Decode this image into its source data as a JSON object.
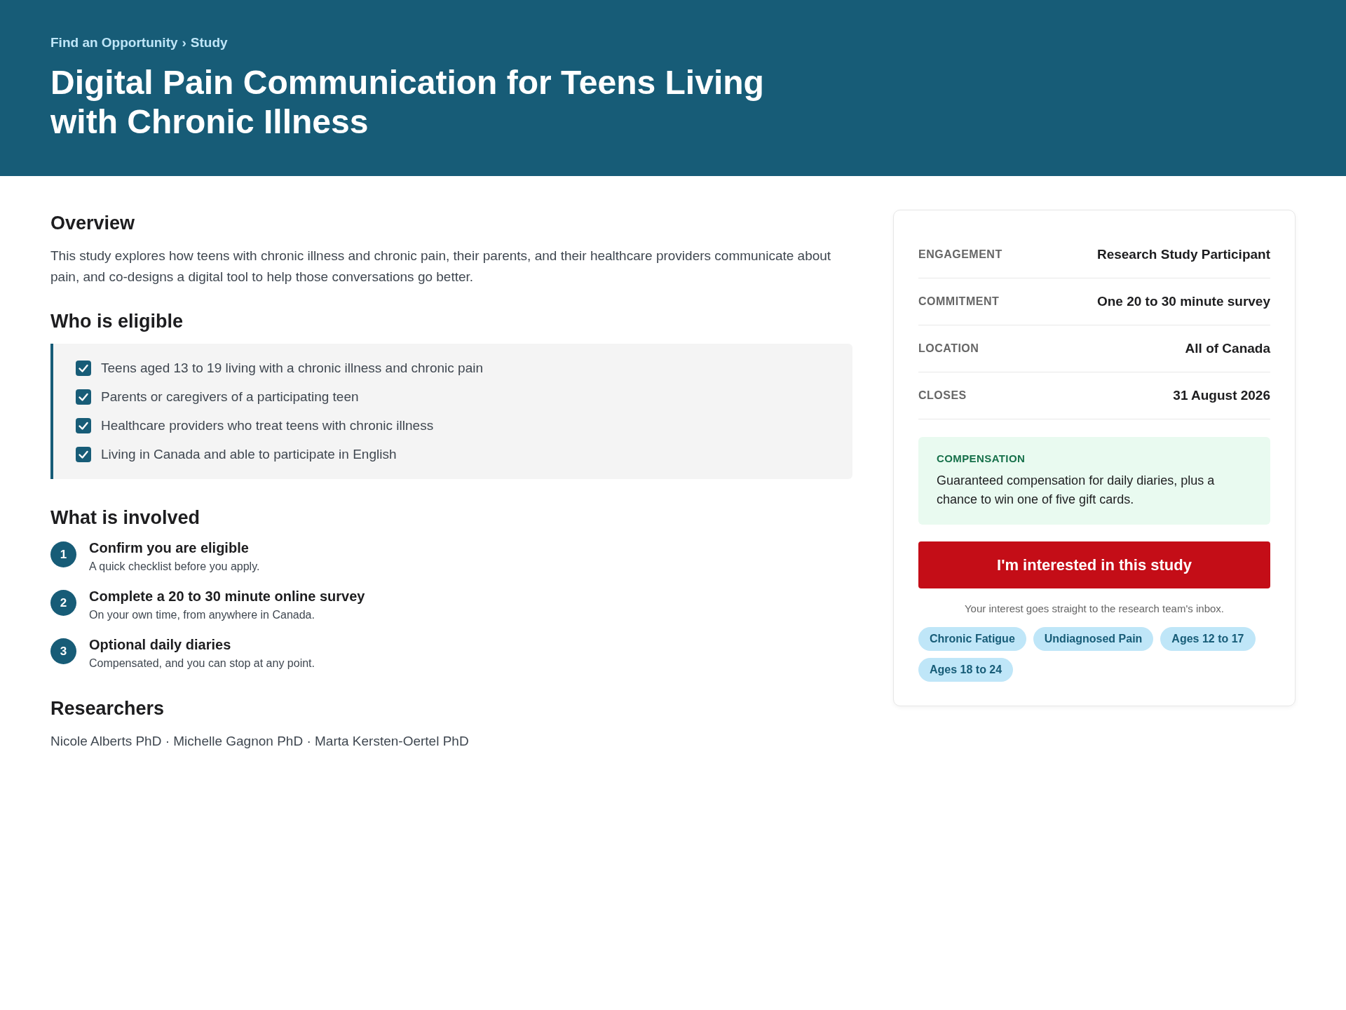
{
  "header": {
    "breadcrumb": {
      "items": [
        "Find an Opportunity",
        "Study"
      ],
      "separator": "›"
    },
    "title": "Digital Pain Communication for Teens Living with Chronic Illness"
  },
  "overview": {
    "heading": "Overview",
    "text": "This study explores how teens with chronic illness and chronic pain, their parents, and their healthcare providers communicate about pain, and co-designs a digital tool to help those conversations go better."
  },
  "eligibility": {
    "heading": "Who is eligible",
    "items": [
      {
        "text": "Teens aged 13 to 19 living with a chronic illness and chronic pain",
        "checked": true
      },
      {
        "text": "Parents or caregivers of a participating teen",
        "checked": true
      },
      {
        "text": "Healthcare providers who treat teens with chronic illness",
        "checked": true
      },
      {
        "text": "Living in Canada and able to participate in English",
        "checked": true
      }
    ]
  },
  "involved": {
    "heading": "What is involved",
    "steps": [
      {
        "number": "1",
        "title": "Confirm you are eligible",
        "text": "A quick checklist before you apply."
      },
      {
        "number": "2",
        "title": "Complete a 20 to 30 minute online survey",
        "text": "On your own time, from anywhere in Canada."
      },
      {
        "number": "3",
        "title": "Optional daily diaries",
        "text": "Compensated, and you can stop at any point."
      }
    ]
  },
  "researchers": {
    "heading": "Researchers",
    "text": "Nicole Alberts PhD · Michelle Gagnon PhD · Marta Kersten-Oertel PhD"
  },
  "sidebar": {
    "details": [
      {
        "label": "ENGAGEMENT",
        "value": "Research Study Participant"
      },
      {
        "label": "COMMITMENT",
        "value": "One 20 to 30 minute survey"
      },
      {
        "label": "LOCATION",
        "value": "All of Canada"
      },
      {
        "label": "CLOSES",
        "value": "31 August 2026"
      }
    ],
    "compensation": {
      "label": "COMPENSATION",
      "text": "Guaranteed compensation for daily diaries, plus a chance to win one of five gift cards."
    },
    "button": "I'm interested in this study",
    "note": "Your interest goes straight to the research team's inbox.",
    "tags": [
      "Chronic Fatigue",
      "Undiagnosed Pain",
      "Ages 12 to 17",
      "Ages 18 to 24"
    ]
  }
}
